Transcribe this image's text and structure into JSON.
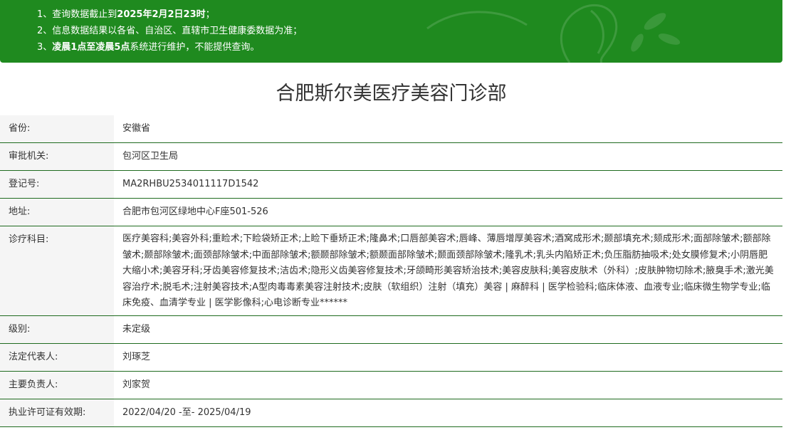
{
  "notice": {
    "line1_prefix": "1、查询数据截止到",
    "line1_bold": "2025年2月2日23时",
    "line1_suffix": "；",
    "line2": "2、信息数据结果以各省、自治区、直辖市卫生健康委数据为准；",
    "line3_prefix": "3、",
    "line3_bold": "凌晨1点至凌晨5点",
    "line3_suffix": "系统进行维护，不能提供查询。",
    "colors": {
      "background": "#1f8a1f",
      "text": "#ffffff"
    },
    "decoration_icon": "woman-silhouette-watermark-icon"
  },
  "title": "合肥斯尔美医疗美容门诊部",
  "table": {
    "border_color": "#1f6b1f",
    "label_bg": "#f5f5f5",
    "rows": [
      {
        "label": "省份:",
        "value": "安徽省"
      },
      {
        "label": "审批机关:",
        "value": "包河区卫生局"
      },
      {
        "label": "登记号:",
        "value": "MA2RHBU2534011117D1542"
      },
      {
        "label": "地址:",
        "value": "合肥市包河区绿地中心F座501-526"
      },
      {
        "label": "诊疗科目:",
        "value": "医疗美容科;美容外科;重睑术;下睑袋矫正术;上睑下垂矫正术;隆鼻术;口唇部美容术;唇峰、薄唇增厚美容术;酒窝成形术;颞部填充术;颏成形术;面部除皱术;额部除皱术;颞部除皱术;面颈部除皱术;中面部除皱术;额颞部除皱术;额颞面部除皱术;颞面颈部除皱术;隆乳术;乳头内陷矫正术;负压脂肪抽吸术;处女膜修复术;小阴唇肥大缩小术;美容牙科;牙齿美容修复技术;洁齿术;隐形义齿美容修复技术;牙颌畸形美容矫治技术;美容皮肤科;美容皮肤术（外科）;皮肤肿物切除术;腋臭手术;激光美容治疗术;脱毛术;注射美容技术;A型肉毒毒素美容注射技术;皮肤（软组织）注射（填充）美容 | 麻醉科 | 医学检验科;临床体液、血液专业;临床微生物学专业;临床免疫、血清学专业 | 医学影像科;心电诊断专业******"
      },
      {
        "label": "级别:",
        "value": "未定级"
      },
      {
        "label": "法定代表人:",
        "value": "刘琢芝"
      },
      {
        "label": "主要负责人:",
        "value": "刘家贺"
      },
      {
        "label": "执业许可证有效期:",
        "value": "2022/04/20 -至- 2025/04/19"
      }
    ]
  }
}
